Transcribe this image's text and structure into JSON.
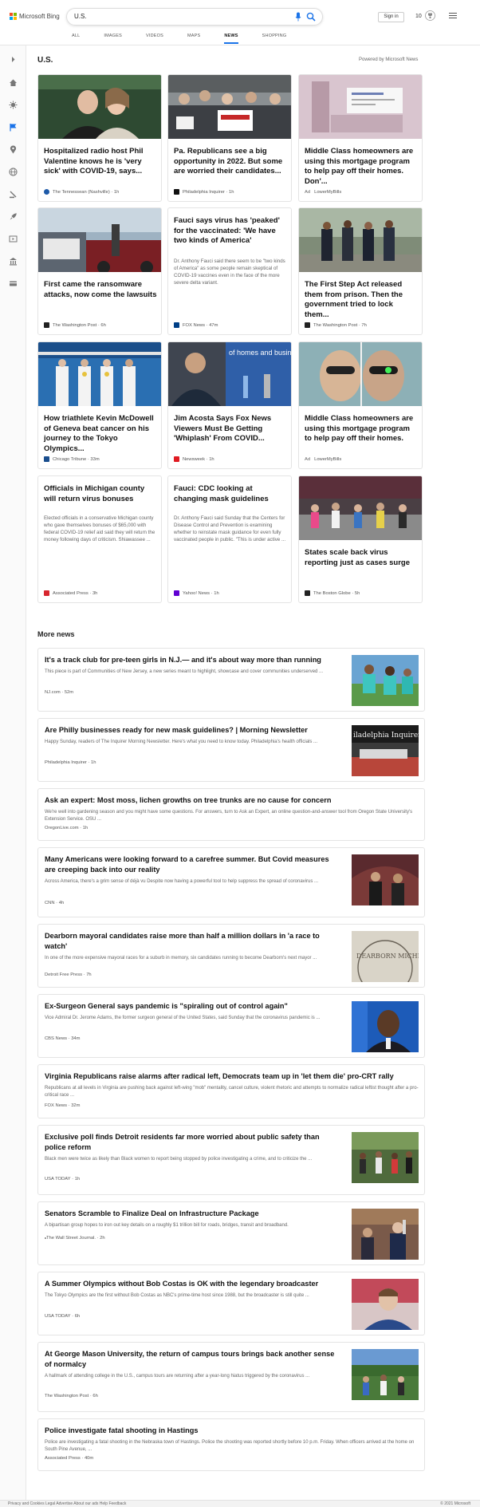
{
  "header": {
    "brand": "Microsoft Bing",
    "search_value": "U.S.",
    "signin_label": "Sign in",
    "rewards_count": "10",
    "tabs": [
      "ALL",
      "IMAGES",
      "VIDEOS",
      "MAPS",
      "NEWS",
      "SHOPPING"
    ],
    "active_tab": "NEWS"
  },
  "colors": {
    "accent": "#1a73e8",
    "logo": [
      "#f25022",
      "#7fba00",
      "#00a4ef",
      "#ffb900"
    ]
  },
  "sidebar_icons": [
    "chevron-right-icon",
    "home-icon",
    "coronavirus-icon",
    "flag-icon",
    "location-icon",
    "globe-icon",
    "scale-icon",
    "rocket-icon",
    "film-icon",
    "bank-icon",
    "card-icon"
  ],
  "main": {
    "section_title": "U.S.",
    "powered_by": "Powered by Microsoft News",
    "cards": [
      {
        "title": "Hospitalized radio host Phil Valentine knows he is 'very sick' with COVID-19, says...",
        "source": "The Tennessean (Nashville)",
        "time": "1h",
        "snippet": ""
      },
      {
        "title": "Pa. Republicans see a big opportunity in 2022. But some are worried their candidates...",
        "source": "Philadelphia Inquirer",
        "time": "1h",
        "snippet": ""
      },
      {
        "title": "Middle Class homeowners are using this mortgage program to help pay off their homes. Don'...",
        "source": "LowerMyBills",
        "time": "",
        "ad": "Ad",
        "snippet": ""
      },
      {
        "title": "First came the ransomware attacks, now come the lawsuits",
        "source": "The Washington Post",
        "time": "6h",
        "snippet": ""
      },
      {
        "title": "Fauci says virus has 'peaked' for the vaccinated: 'We have two kinds of America'",
        "source": "FOX News",
        "time": "47m",
        "snippet": "Dr. Anthony Fauci said there seem to be \"two kinds of America\" as some people remain skeptical of COVID-19 vaccines even in the face of the more severe delta variant."
      },
      {
        "title": "The First Step Act released them from prison. Then the government tried to lock them...",
        "source": "The Washington Post",
        "time": "7h",
        "snippet": ""
      },
      {
        "title": "How triathlete Kevin McDowell of Geneva beat cancer on his journey to the Tokyo Olympics...",
        "source": "Chicago Tribune",
        "time": "33m",
        "snippet": ""
      },
      {
        "title": "Jim Acosta Says Fox News Viewers Must Be Getting 'Whiplash' From COVID...",
        "source": "Newsweek",
        "time": "1h",
        "snippet": "",
        "img_text": "of homes and busine"
      },
      {
        "title": "Middle Class homeowners are using this mortgage program to help pay off their homes.",
        "source": "LowerMyBills",
        "time": "",
        "ad": "Ad",
        "snippet": ""
      },
      {
        "title": "Officials in Michigan county will return virus bonuses",
        "source": "Associated Press",
        "time": "3h",
        "snippet": "Elected officials in a conservative Michigan county who gave themselves bonuses of $65,000 with federal COVID-19 relief aid said they will return the money following days of criticism. Shiawassee ..."
      },
      {
        "title": "Fauci: CDC looking at changing mask guidelines",
        "source": "Yahoo! News",
        "time": "1h",
        "snippet": "Dr. Anthony Fauci said Sunday that the Centers for Disease Control and Prevention is examining whether to reinstate mask guidance for even fully vaccinated people in public. \"This is under active ..."
      },
      {
        "title": "States scale back virus reporting just as cases surge",
        "source": "The Boston Globe",
        "time": "5h",
        "snippet": ""
      }
    ],
    "more_news_title": "More news",
    "more_news": [
      {
        "title": "It's a track club for pre-teen girls in N.J.— and it's about way more than running",
        "snippet": "This piece is part of Communities of New Jersey, a new series meant to highlight, showcase and cover communities underserved ...",
        "source": "NJ.com",
        "time": "52m"
      },
      {
        "title": "Are Philly businesses ready for new mask guidelines? | Morning Newsletter",
        "snippet": "Happy Sunday, readers of The Inquirer Morning Newsletter. Here's what you need to know today. Philadelphia's health officials ...",
        "source": "Philadelphia Inquirer",
        "time": "1h",
        "img_text": "iladelphia Inquirer"
      },
      {
        "title": "Ask an expert: Most moss, lichen growths on tree trunks are no cause for concern",
        "snippet": "We're well into gardening season and you might have some questions. For answers, turn to Ask an Expert, an online question-and-answer tool from Oregon State University's Extension Service. OSU ...",
        "source": "OregonLive.com",
        "time": "1h"
      },
      {
        "title": "Many Americans were looking forward to a carefree summer. But Covid measures are creeping back into our reality",
        "snippet": "Across America, there's a grim sense of déjà vu Despite now having a powerful tool to help suppress the spread of coronavirus ...",
        "source": "CNN",
        "time": "4h"
      },
      {
        "title": "Dearborn mayoral candidates raise more than half a million dollars in 'a race to watch'",
        "snippet": "In one of the more expensive mayoral races for a suburb in memory, six candidates running to become Dearborn's next mayor ...",
        "source": "Detroit Free Press",
        "time": "7h",
        "img_text": "DEARBORN MICHIG"
      },
      {
        "title": "Ex-Surgeon General says pandemic is \"spiraling out of control again\"",
        "snippet": "Vice Admiral Dr. Jerome Adams, the former surgeon general of the United States, said Sunday that the coronavirus pandemic is ...",
        "source": "CBS News",
        "time": "34m"
      },
      {
        "title": "Virginia Republicans raise alarms after radical left, Democrats team up in 'let them die' pro-CRT rally",
        "snippet": "Republicans at all levels in Virginia are pushing back against left-wing \"mob\" mentality, cancel culture, violent rhetoric and attempts to normalize radical leftist thought after a pro-critical race ...",
        "source": "FOX News",
        "time": "32m"
      },
      {
        "title": "Exclusive poll finds Detroit residents far more worried about public safety than police reform",
        "snippet": "Black men were twice as likely than Black women to report being stopped by police investigating a crime, and to criticize the ...",
        "source": "USA TODAY",
        "time": "1h"
      },
      {
        "title": "Senators Scramble to Finalize Deal on Infrastructure Package",
        "snippet": "A bipartisan group hopes to iron out key details on a roughly $1 trillion bill for roads, bridges, transit and broadband.",
        "source": "The Wall Street Journal.",
        "time": "2h"
      },
      {
        "title": "A Summer Olympics without Bob Costas is OK with the legendary broadcaster",
        "snippet": "The Tokyo Olympics are the first without Bob Costas as NBC's prime-time host since 1988, but the broadcaster is still quite ...",
        "source": "USA TODAY",
        "time": "6h"
      },
      {
        "title": "At George Mason University, the return of campus tours brings back another sense of normalcy",
        "snippet": "A hallmark of attending college in the U.S., campus tours are returning after a year-long hiatus triggered by the coronavirus ...",
        "source": "The Washington Post",
        "time": "6h"
      },
      {
        "title": "Police investigate fatal shooting in Hastings",
        "snippet": "Police are investigating a fatal shooting in the Nebraska town of Hastings. Police the shooting was reported shortly before 10 p.m. Friday. When officers arrived at the home on South Pine Avenue, ...",
        "source": "Associated Press",
        "time": "40m"
      }
    ]
  },
  "footer": {
    "left": "Privacy and Cookies  Legal  Advertise  About our ads  Help  Feedback",
    "right": "© 2021 Microsoft"
  }
}
